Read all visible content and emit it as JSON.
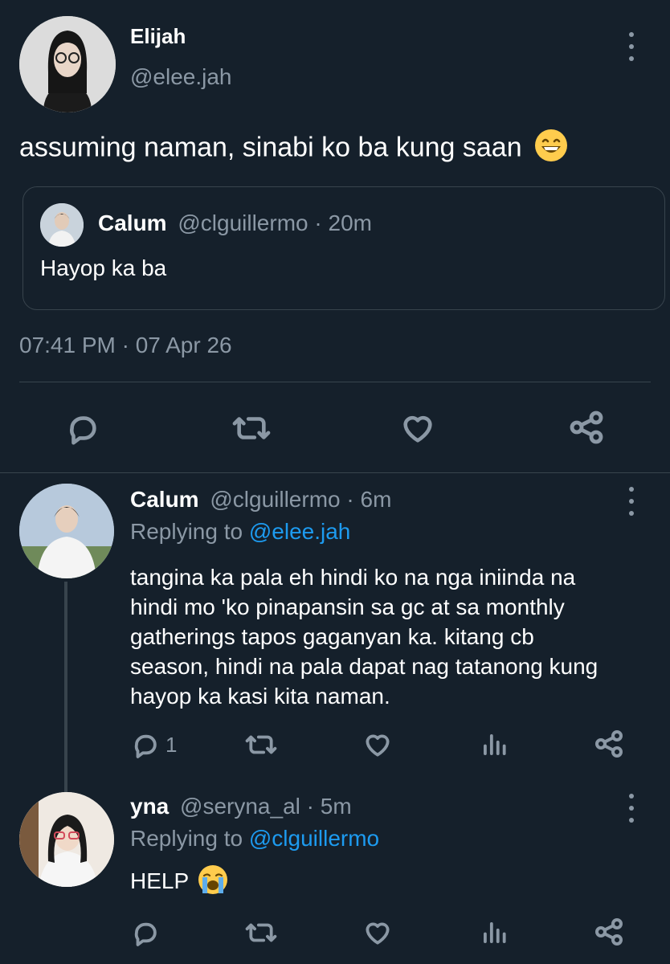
{
  "tweet": {
    "author_name": "Elijah",
    "author_handle": "@elee.jah",
    "text": "assuming naman, sinabi ko ba kung saan",
    "text_emoji": "grinning-face-emoji",
    "quote": {
      "author_name": "Calum",
      "author_handle": "@clguillermo",
      "separator": "·",
      "age": "20m",
      "text": "Hayop ka ba"
    },
    "timestamp": "07:41 PM · 07 Apr 26"
  },
  "replies": [
    {
      "author_name": "Calum",
      "author_handle": "@clguillermo",
      "separator": "·",
      "age": "6m",
      "replying_prefix": "Replying to",
      "replying_to": "@elee.jah",
      "lines": [
        "tangina ka pala eh hindi ko na nga iniinda na",
        "hindi mo 'ko pinapansin sa gc at sa monthly",
        "gatherings tapos gaganyan ka. kitang cb",
        "season, hindi na pala dapat nag tatanong kung",
        "hayop ka kasi kita naman."
      ],
      "reply_count": "1"
    },
    {
      "author_name": "yna",
      "author_handle": "@seryna_al",
      "separator": "·",
      "age": "5m",
      "replying_prefix": "Replying to",
      "replying_to": "@clguillermo",
      "text": "HELP",
      "text_emoji": "loudly-crying-face-emoji"
    }
  ],
  "colors": {
    "background": "#15202b",
    "text": "#ffffff",
    "muted": "#8b98a5",
    "link": "#1d9bf0",
    "divider": "#38444d"
  }
}
